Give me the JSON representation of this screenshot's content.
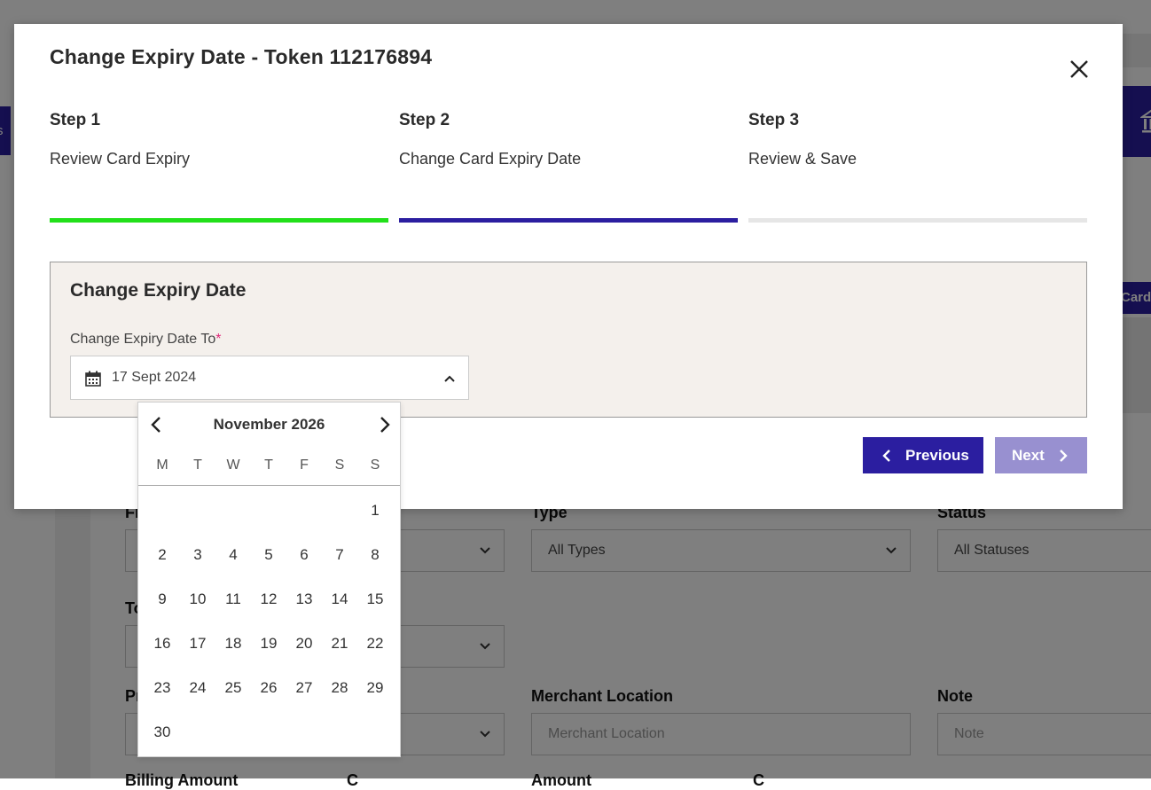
{
  "background": {
    "tab_left_text": "s",
    "card_button": "Card",
    "fields": [
      {
        "label": "Fr",
        "value": "",
        "type": "select"
      },
      {
        "label": "Type",
        "value": "All Types",
        "type": "select"
      },
      {
        "label": "Status",
        "value": "All Statuses",
        "type": "select"
      },
      {
        "label": "To",
        "value": "",
        "type": "select"
      },
      {
        "label": "Pr",
        "value": "",
        "type": "select"
      },
      {
        "label": "Merchant Location",
        "placeholder": "Merchant Location",
        "type": "input"
      },
      {
        "label": "Note",
        "placeholder": "Note",
        "type": "input"
      }
    ],
    "bottom_labels": [
      "Billing Amount",
      "C",
      "Amount",
      "C"
    ]
  },
  "modal": {
    "title": "Change Expiry Date - Token 112176894",
    "steps": [
      {
        "number": "Step 1",
        "label": "Review Card Expiry",
        "state": "complete",
        "color": "#22e01a"
      },
      {
        "number": "Step 2",
        "label": "Change Card Expiry Date",
        "state": "active",
        "color": "#2b1ea0"
      },
      {
        "number": "Step 3",
        "label": "Review & Save",
        "state": "pending",
        "color": "#e6e6e6"
      }
    ],
    "panel": {
      "title": "Change Expiry Date",
      "field_label": "Change Expiry Date To",
      "required_marker": "*",
      "date_value": "17 Sept 2024"
    },
    "buttons": {
      "previous": "Previous",
      "next": "Next"
    }
  },
  "calendar": {
    "month_label": "November 2026",
    "weekdays": [
      "M",
      "T",
      "W",
      "T",
      "F",
      "S",
      "S"
    ],
    "weeks": [
      [
        "",
        "",
        "",
        "",
        "",
        "",
        "1"
      ],
      [
        "2",
        "3",
        "4",
        "5",
        "6",
        "7",
        "8"
      ],
      [
        "9",
        "10",
        "11",
        "12",
        "13",
        "14",
        "15"
      ],
      [
        "16",
        "17",
        "18",
        "19",
        "20",
        "21",
        "22"
      ],
      [
        "23",
        "24",
        "25",
        "26",
        "27",
        "28",
        "29"
      ],
      [
        "30",
        "",
        "",
        "",
        "",
        "",
        ""
      ]
    ]
  },
  "colors": {
    "brand": "#2b1ea0",
    "brand_disabled": "#9890d0",
    "step_complete": "#22e01a",
    "step_pending": "#e6e6e6",
    "panel_bg": "#f4f0ec",
    "required": "#e0287a"
  }
}
